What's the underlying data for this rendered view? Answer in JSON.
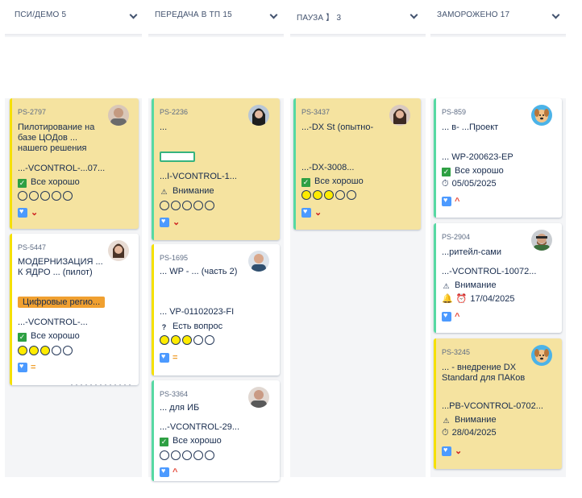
{
  "columns": [
    {
      "title": "ПСИ/ДЕМО",
      "count": "5"
    },
    {
      "title": "ПЕРЕДАЧА В ТП",
      "count": "15"
    },
    {
      "title": "ПАУЗА",
      "count": "3"
    },
    {
      "title": "ЗАМОРОЖЕНО",
      "count": "17"
    }
  ],
  "pause_bracket": "】",
  "cards": {
    "c1": {
      "key": "PS-2797",
      "title": "Пилотирование на базе ЦОДов ... нашего решения",
      "code": "...-VCONTROL-...07...",
      "status": "Все хорошо",
      "rating": 0
    },
    "c2": {
      "key": "PS-5447",
      "title": "МОДЕРНИЗАЦИЯ ... К ЯДРО ... (пилот)",
      "tag": "Цифровые регио...",
      "code": "...-VCONTROL-...",
      "status": "Все хорошо",
      "rating": 3
    },
    "c3": {
      "key": "PS-2236",
      "title": "...",
      "code": "...I-VCONTROL-1...",
      "status": "Внимание",
      "rating": 0
    },
    "c4": {
      "key": "PS-1695",
      "title": "... WP - ... (часть 2)",
      "code": "... VP-01102023-FI",
      "status": "Есть вопрос",
      "rating": 3
    },
    "c5": {
      "key": "PS-3364",
      "title": "... для ИБ",
      "code": "...-VCONTROL-29...",
      "status": "Все хорошо",
      "rating": 0
    },
    "c6": {
      "key": "PS-3437",
      "title": "...-DX St (опытно-",
      "code": "...-DX-3008...",
      "status": "Все хорошо",
      "rating": 3
    },
    "c7": {
      "key": "PS-859",
      "title": "... в- ...Проект",
      "code": "... WP-200623-EP",
      "status": "Все хорошо",
      "date": "05/05/2025"
    },
    "c8": {
      "key": "PS-2904",
      "title": "...ритейл-сами",
      "code": "...-VCONTROL-10072...",
      "status": "Внимание",
      "date": "17/04/2025"
    },
    "c9": {
      "key": "PS-3245",
      "title": "... - внедрение DX Standard для ПАКов",
      "code": "...PB-VCONTROL-0702...",
      "status": "Внимание",
      "date": "28/04/2025"
    }
  },
  "colors": {
    "accent": "#4c9aff",
    "ok": "#2ea043",
    "yellow_card": "#f5e3a0",
    "stripe_yellow": "#f5e000",
    "stripe_green": "#57d9a3",
    "tag_orange": "#f0a030"
  },
  "icons": [
    "chevron-down-icon",
    "check-icon",
    "warning-icon",
    "question-icon",
    "flag-icon",
    "priority-high-icon",
    "priority-medium-icon",
    "bell-icon",
    "alarm-icon",
    "timer-icon",
    "avatar"
  ]
}
